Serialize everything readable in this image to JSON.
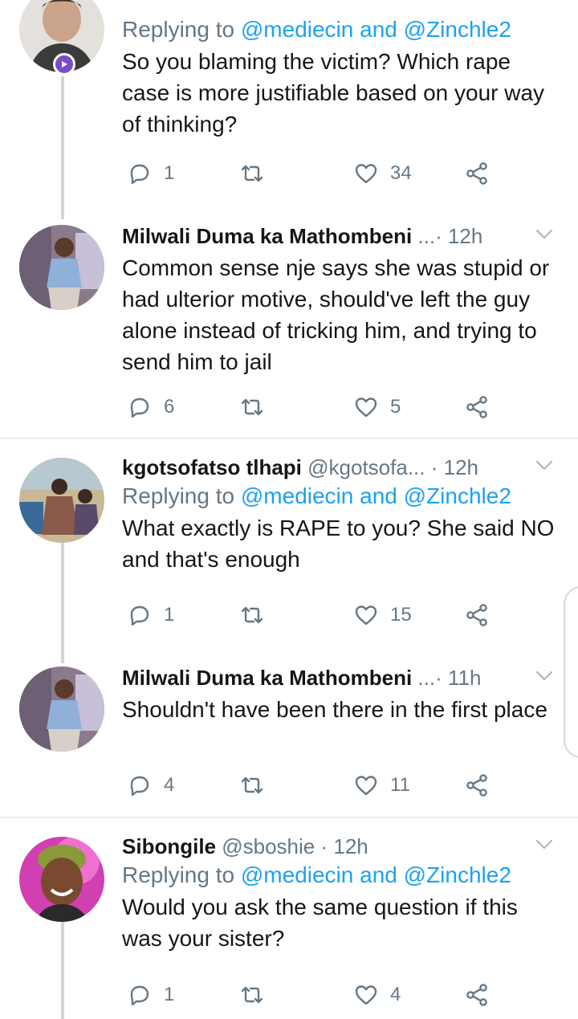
{
  "tweets": [
    {
      "name": "",
      "handle": "",
      "time": "",
      "replying_prefix": "Replying to",
      "replying_to": "@mediecin and @Zinchle2",
      "text": "So you blaming the victim? Which rape case is more justifiable based on your way of thinking?",
      "reply_count": "1",
      "retweet_count": "",
      "like_count": "34"
    },
    {
      "name": "Milwali Duma ka Mathombeni",
      "handle": "...",
      "time": "· 12h",
      "text": "Common sense nje says she was stupid or had ulterior motive, should've left the guy alone instead of tricking him, and trying to send him to jail",
      "reply_count": "6",
      "retweet_count": "",
      "like_count": "5"
    },
    {
      "name": "kgotsofatso tlhapi",
      "handle": "@kgotsofa...",
      "time": "· 12h",
      "replying_prefix": "Replying to",
      "replying_to": "@mediecin and @Zinchle2",
      "text": "What exactly is RAPE to you? She said NO and that's enough",
      "reply_count": "1",
      "retweet_count": "",
      "like_count": "15"
    },
    {
      "name": "Milwali Duma ka Mathombeni",
      "handle": "...",
      "time": "· 11h",
      "text": "Shouldn't have been there in the first place",
      "reply_count": "4",
      "retweet_count": "",
      "like_count": "11"
    },
    {
      "name": "Sibongile",
      "handle": "@sboshie",
      "time": "· 12h",
      "replying_prefix": "Replying to",
      "replying_to": "@mediecin and @Zinchle2",
      "text": "Would you ask the same question if this was your sister?",
      "reply_count": "1",
      "retweet_count": "",
      "like_count": "4"
    }
  ],
  "icons": {
    "reply": "reply-icon",
    "retweet": "retweet-icon",
    "like": "heart-icon",
    "share": "share-icon",
    "menu": "chevron-down-icon"
  },
  "colors": {
    "link": "#1da1f2",
    "secondary_text": "#657786",
    "divider": "#e6ecf0",
    "thread_line": "#ccd6dd"
  }
}
